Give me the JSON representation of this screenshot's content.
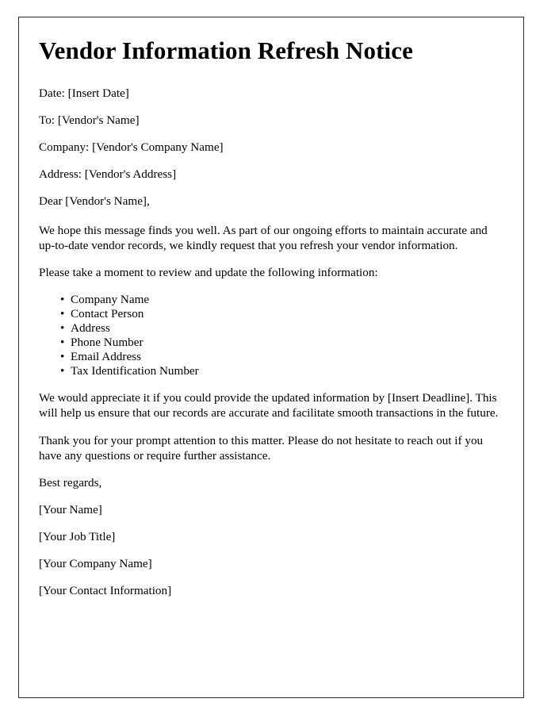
{
  "document": {
    "title": "Vendor Information Refresh Notice",
    "header_fields": [
      {
        "text": "Date: [Insert Date]"
      },
      {
        "text": "To: [Vendor's Name]"
      },
      {
        "text": "Company: [Vendor's Company Name]"
      },
      {
        "text": "Address: [Vendor's Address]"
      }
    ],
    "salutation": "Dear [Vendor's Name],",
    "paragraph_intro": "We hope this message finds you well. As part of our ongoing efforts to maintain accurate and up-to-date vendor records, we kindly request that you refresh your vendor information.",
    "paragraph_review": "Please take a moment to review and update the following information:",
    "bullet_marker": "•",
    "bullets": [
      {
        "label": "Company Name"
      },
      {
        "label": "Contact Person"
      },
      {
        "label": "Address"
      },
      {
        "label": "Phone Number"
      },
      {
        "label": "Email Address"
      },
      {
        "label": "Tax Identification Number"
      }
    ],
    "paragraph_deadline": "We would appreciate it if you could provide the updated information by [Insert Deadline]. This will help us ensure that our records are accurate and facilitate smooth transactions in the future.",
    "paragraph_thanks": "Thank you for your prompt attention to this matter. Please do not hesitate to reach out if you have any questions or require further assistance.",
    "closing": "Best regards,",
    "signature_lines": [
      {
        "text": "[Your Name]"
      },
      {
        "text": "[Your Job Title]"
      },
      {
        "text": "[Your Company Name]"
      },
      {
        "text": "[Your Contact Information]"
      }
    ]
  },
  "colors": {
    "page_background": "#ffffff",
    "border": "#2b2b2b",
    "text": "#000000"
  }
}
